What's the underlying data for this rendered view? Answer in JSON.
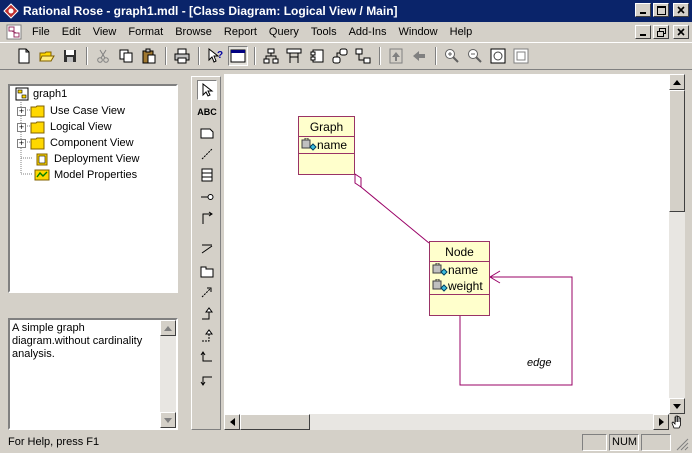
{
  "window": {
    "title": "Rational Rose - graph1.mdl - [Class Diagram: Logical View / Main]"
  },
  "menu": [
    "File",
    "Edit",
    "View",
    "Format",
    "Browse",
    "Report",
    "Query",
    "Tools",
    "Add-Ins",
    "Window",
    "Help"
  ],
  "tree": {
    "root": "graph1",
    "items": [
      "Use Case View",
      "Logical View",
      "Component View",
      "Deployment View",
      "Model Properties"
    ]
  },
  "documentation": "A simple graph diagram.without cardinality analysis.",
  "toolbox": {
    "text_tool": "ABC"
  },
  "diagram": {
    "classes": [
      {
        "name": "Graph",
        "attributes": [
          "name"
        ]
      },
      {
        "name": "Node",
        "attributes": [
          "name",
          "weight"
        ]
      }
    ],
    "edge_label": "edge"
  },
  "status": {
    "help": "For Help, press F1",
    "num": "NUM"
  },
  "colors": {
    "titlebar": "#0a246a",
    "class_fill": "#ffffcc",
    "class_border": "#993366",
    "relation": "#990066"
  }
}
